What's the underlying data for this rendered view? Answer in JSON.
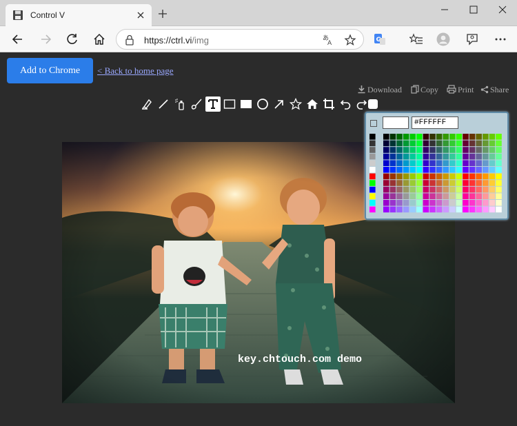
{
  "browser": {
    "tab_title": "Control V",
    "url_host": "https://ctrl.vi",
    "url_path": "/img"
  },
  "page": {
    "add_button": "Add to Chrome",
    "back_link": "< Back to home page",
    "actions": {
      "download": "Download",
      "copy": "Copy",
      "print": "Print",
      "share": "Share"
    },
    "toolbar_tools": [
      "highlighter-icon",
      "line-icon",
      "spray-icon",
      "brush-icon",
      "text-icon",
      "rectangle-outline-icon",
      "rectangle-filled-icon",
      "circle-icon",
      "arrow-icon",
      "star-icon",
      "home-icon",
      "crop-icon",
      "undo-icon",
      "redo-icon",
      "color-swatch-icon"
    ],
    "active_tool": "text-icon",
    "color_picker": {
      "hex_value": "#FFFFFF",
      "preview_color": "#FFFFFF"
    },
    "watermark": "key.chtouch.com demo"
  }
}
